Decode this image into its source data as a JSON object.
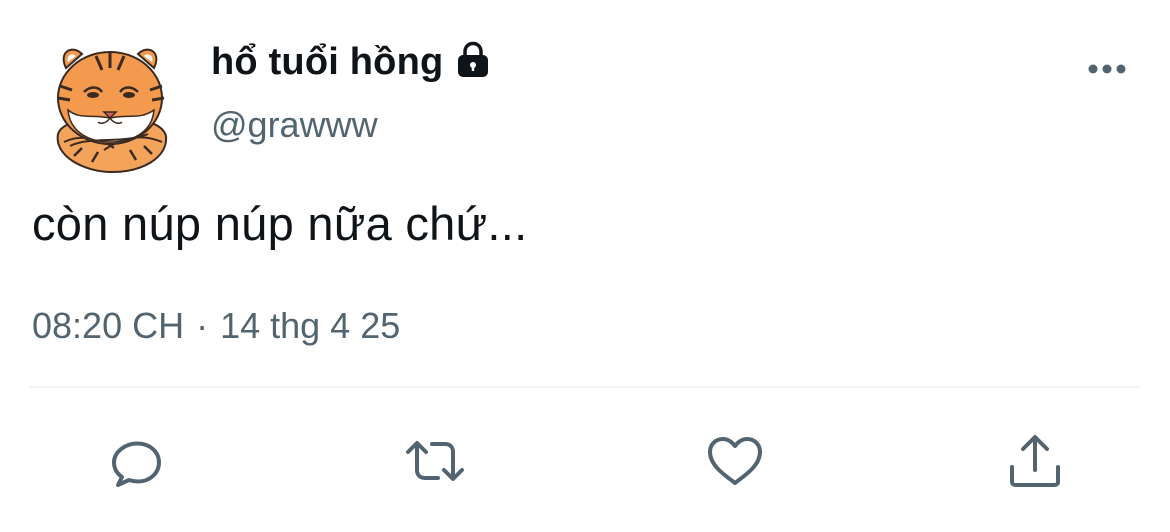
{
  "tweet": {
    "display_name": "hổ tuổi hồng",
    "handle": "@grawww",
    "text": "còn núp núp nữa chứ...",
    "time": "08:20 CH",
    "separator": "·",
    "date": "14 thg 4 25"
  },
  "icons": {
    "avatar": "tiger-avatar",
    "protected": "lock-icon",
    "more": "more-dots-icon",
    "reply": "reply-icon",
    "retweet": "retweet-icon",
    "like": "heart-icon",
    "share": "share-icon"
  },
  "colors": {
    "text_primary": "#0f1419",
    "text_secondary": "#536471",
    "icon": "#536471",
    "divider": "#eff3f4"
  }
}
